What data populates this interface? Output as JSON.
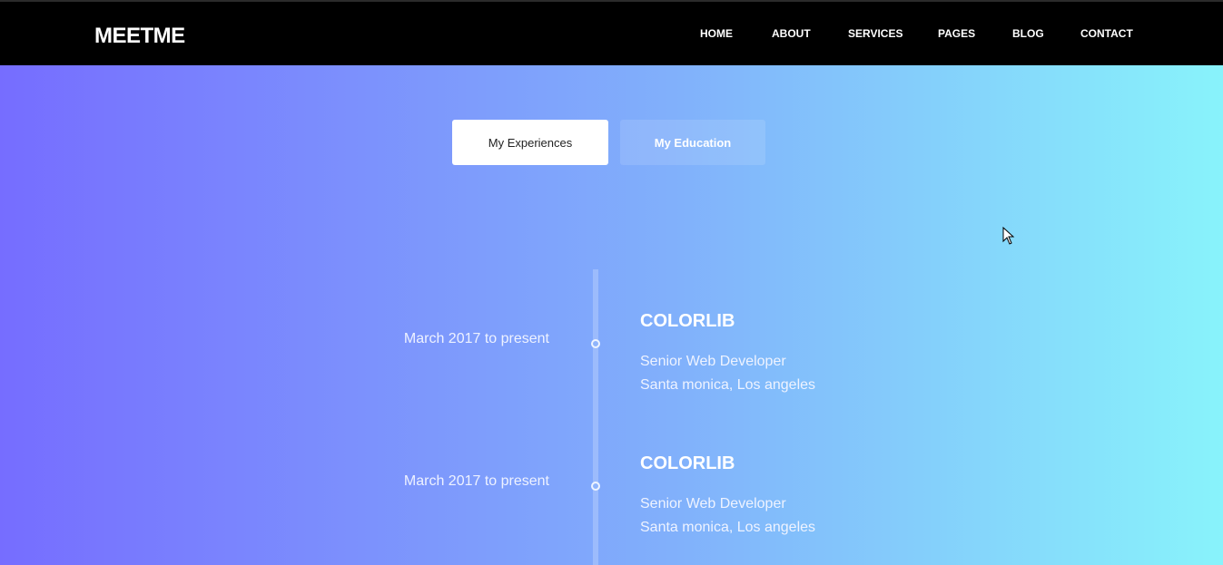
{
  "header": {
    "logo": "MEETME",
    "nav": [
      "HOME",
      "ABOUT",
      "SERVICES",
      "PAGES",
      "BLOG",
      "CONTACT"
    ]
  },
  "tabs": [
    {
      "label": "My Experiences",
      "active": true
    },
    {
      "label": "My Education",
      "active": false
    }
  ],
  "timeline": [
    {
      "date": "March 2017 to present",
      "company": "COLORLIB",
      "role": "Senior Web Developer",
      "location": "Santa monica, Los angeles"
    },
    {
      "date": "March 2017 to present",
      "company": "COLORLIB",
      "role": "Senior Web Developer",
      "location": "Santa monica, Los angeles"
    }
  ],
  "colors": {
    "gradient_start": "#766dff",
    "gradient_end": "#88f3fb",
    "header_bg": "#000000"
  }
}
